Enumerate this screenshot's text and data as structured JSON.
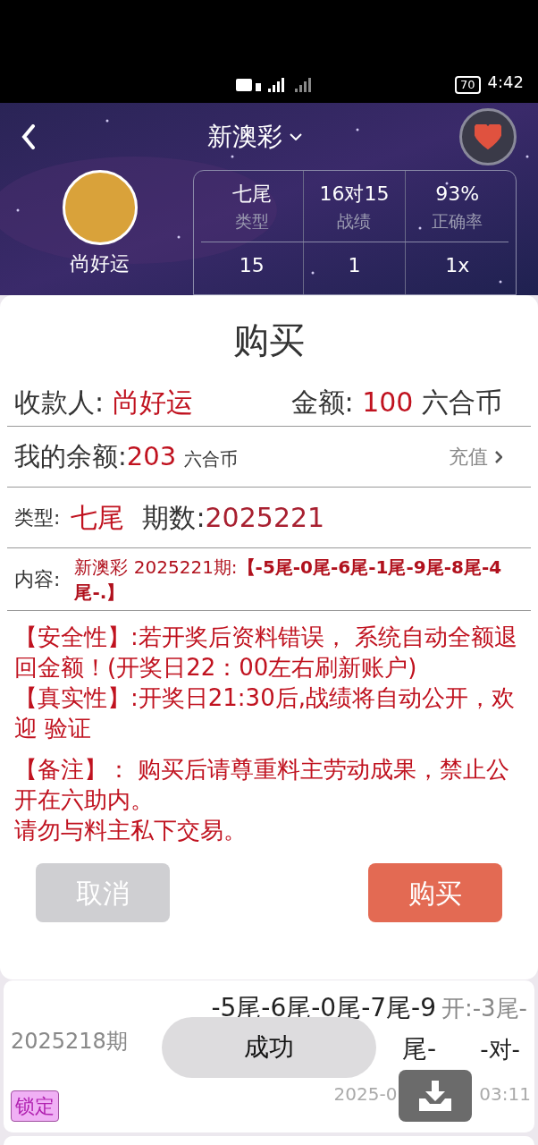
{
  "status_bar": {
    "battery": "70",
    "time": "4:42"
  },
  "header": {
    "title": "新澳彩",
    "name": "尚好运",
    "favorite": true,
    "stats": [
      {
        "value": "七尾",
        "label": "类型"
      },
      {
        "value": "16对15",
        "label": "战绩"
      },
      {
        "value": "93%",
        "label": "正确率"
      }
    ],
    "stats_row_2": [
      "15",
      "1",
      "1x"
    ]
  },
  "dialog": {
    "title": "购买",
    "payee_label": "收款人:",
    "payee": "尚好运",
    "amount_label": "金额:",
    "amount": "100",
    "amount_unit": "六合币",
    "balance_label": "我的余额:",
    "balance": "203",
    "balance_unit": "六合币",
    "recharge": "充值",
    "type_label": "类型:",
    "type": "七尾",
    "period_label": "期数:",
    "period": "2025221",
    "content_label": "内容:",
    "content": "新澳彩 2025221期:**【-5尾-0尾-6尾-1尾-9尾-8尾-4尾-.】**",
    "notes": [
      {
        "lines": [
          "【安全性】:若开奖后资料错误， 系统自动全额退回金额！(开奖日22：00左右刷新账户)",
          "【真实性】:开奖日21:30后,战绩将自动公开，欢迎 验证"
        ]
      },
      {
        "lines": [
          "【备注】： 购买后请尊重料主劳动成果，禁止公开在六助内。",
          "请勿与料主私下交易。"
        ]
      }
    ],
    "cancel": "取消",
    "confirm": "购买"
  },
  "record": {
    "period": "2025218期",
    "content_line_1": "-5尾-6尾-0尾-7尾-9",
    "content_line_2": "尾-",
    "result_line_1": "开:-3尾-",
    "result_line_2": "-对-",
    "badge": "锁定",
    "time_start": "2025-0",
    "time_end": "03:11"
  },
  "toast": "成功"
}
